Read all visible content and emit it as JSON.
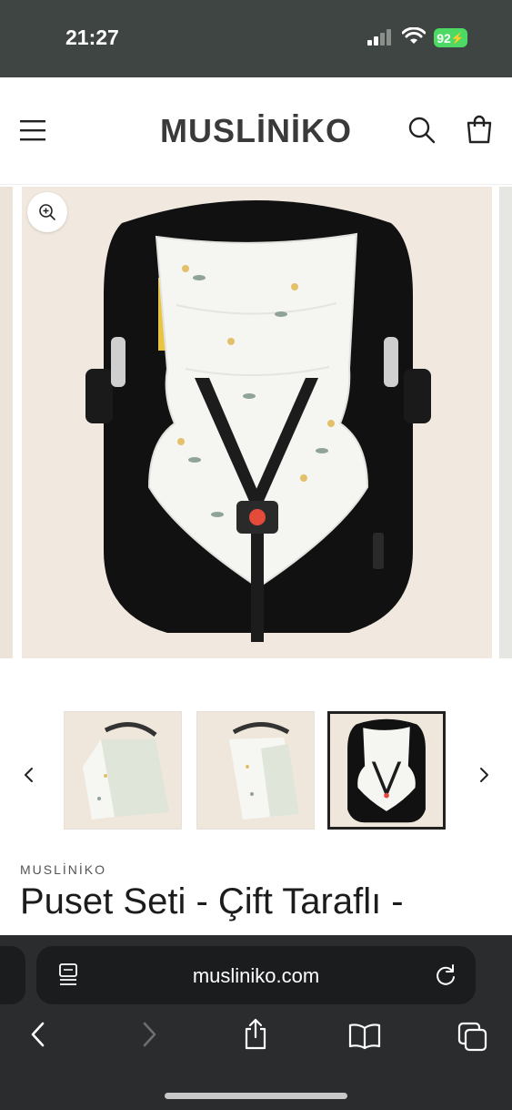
{
  "status_bar": {
    "time": "21:27",
    "battery": "92",
    "signal_icon": "cellular-signal-icon",
    "wifi_icon": "wifi-icon"
  },
  "header": {
    "logo": "MUSLİNİKO",
    "menu_icon": "hamburger-menu-icon",
    "search_icon": "search-icon",
    "cart_icon": "cart-icon"
  },
  "gallery": {
    "zoom_icon": "zoom-in-icon",
    "main_image": "baby-car-seat-with-floral-muslin-cushion"
  },
  "thumbnails": {
    "prev_icon": "chevron-left-icon",
    "next_icon": "chevron-right-icon",
    "items": [
      {
        "name": "car-seat-canopy-cover-view-1"
      },
      {
        "name": "car-seat-canopy-cover-view-2"
      },
      {
        "name": "car-seat-cushion-view",
        "active": true
      }
    ]
  },
  "product": {
    "vendor": "MUSLİNİKO",
    "title": "Puset Seti - Çift Taraflı -"
  },
  "browser": {
    "url": "musliniko.com",
    "reader_icon": "reader-mode-icon",
    "reload_icon": "reload-icon",
    "toolbar": [
      "back-icon",
      "forward-icon",
      "share-icon",
      "bookmarks-icon",
      "tabs-icon"
    ]
  },
  "colors": {
    "status_bg": "#3f4542",
    "battery": "#4cd964",
    "browser_bg": "#2b2c2e",
    "urlbar_bg": "#1b1c1d"
  }
}
